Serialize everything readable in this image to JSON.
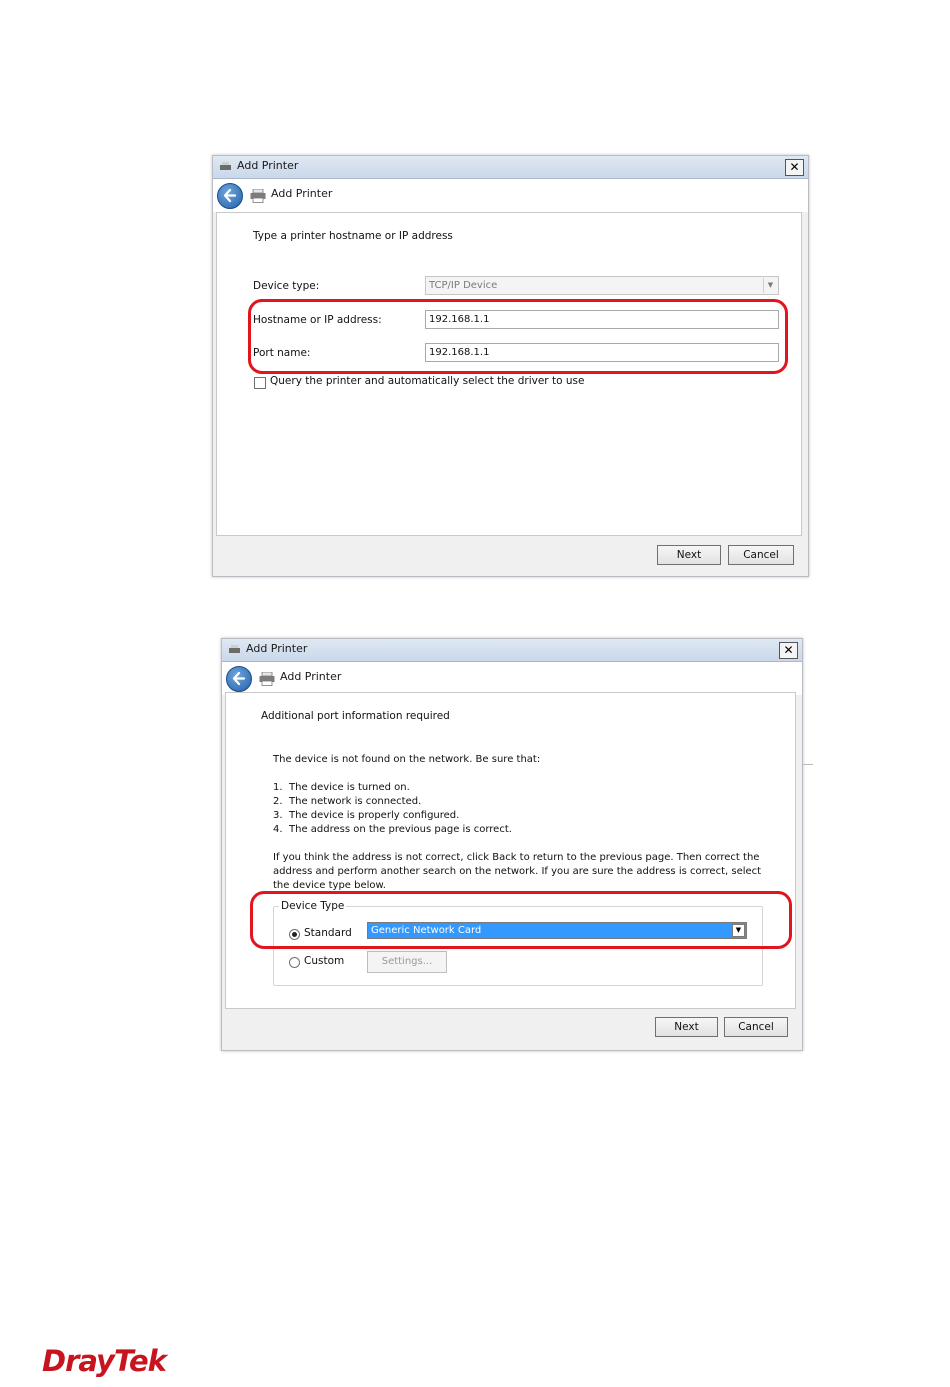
{
  "dialog1": {
    "window_title": "Add Printer",
    "close_glyph": "✕",
    "nav_title": "Add Printer",
    "heading": "Type a printer hostname or IP address",
    "device_type_label": "Device type:",
    "device_type_value": "TCP/IP Device",
    "hostname_label": "Hostname or IP address:",
    "hostname_value": "192.168.1.1",
    "port_label": "Port name:",
    "port_value": "192.168.1.1",
    "query_checkbox_label": "Query the printer and automatically select the driver to use",
    "query_checked": false,
    "next_label": "Next",
    "cancel_label": "Cancel"
  },
  "dialog2": {
    "window_title": "Add Printer",
    "close_glyph": "✕",
    "nav_title": "Add Printer",
    "heading": "Additional port information required",
    "intro": "The device is not found on the network.  Be sure that:",
    "checklist": [
      {
        "num": "1.",
        "text": "The device is turned on."
      },
      {
        "num": "2.",
        "text": "The network is connected."
      },
      {
        "num": "3.",
        "text": "The device is properly configured."
      },
      {
        "num": "4.",
        "text": "The address on the previous page is correct."
      }
    ],
    "advice": "If you think the address is not correct, click Back to return to the previous page.  Then correct the address and perform another search on the network.  If you are sure the address is correct, select the device type below.",
    "group_title": "Device Type",
    "standard_label": "Standard",
    "standard_selected": true,
    "standard_value": "Generic Network Card",
    "custom_label": "Custom",
    "settings_label": "Settings...",
    "next_label": "Next",
    "cancel_label": "Cancel"
  },
  "brand": {
    "logo_text": "DrayTek",
    "logo_color": "#c8141e"
  },
  "colors": {
    "highlight": "#e2141d",
    "selection": "#3399ff"
  }
}
